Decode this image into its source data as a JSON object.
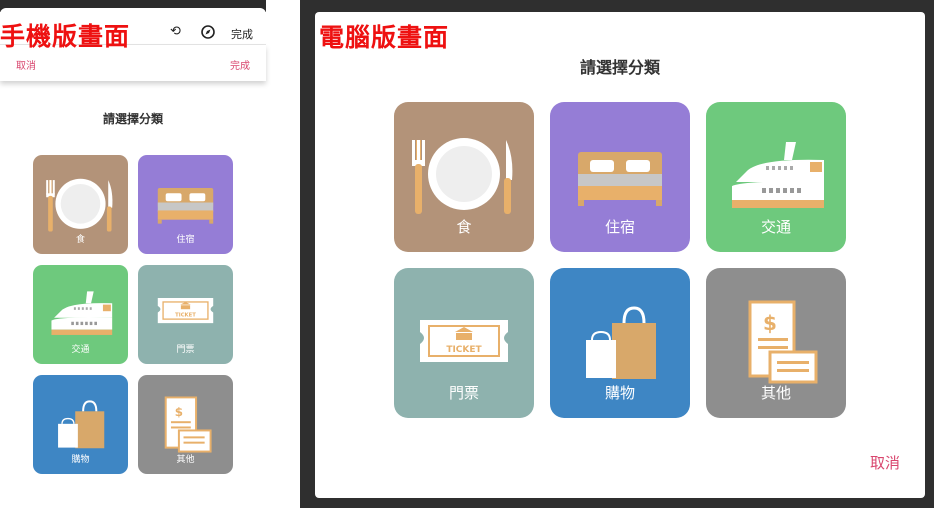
{
  "labels": {
    "mobile": "手機版畫面",
    "desktop": "電腦版畫面"
  },
  "mobile": {
    "toolbar": {
      "done_top": "完成",
      "undo_icon": "undo-icon",
      "compass_icon": "compass-icon"
    },
    "actions": {
      "cancel": "取消",
      "done": "完成"
    },
    "title": "請選擇分類"
  },
  "desktop": {
    "title": "請選擇分類",
    "cancel": "取消"
  },
  "categories": [
    {
      "label": "食",
      "icon": "food-icon",
      "color": "#b39379"
    },
    {
      "label": "住宿",
      "icon": "bed-icon",
      "color": "#957dd6"
    },
    {
      "label": "交通",
      "icon": "train-icon",
      "color": "#6ec97d"
    },
    {
      "label": "門票",
      "icon": "ticket-icon",
      "color": "#8eb2ae"
    },
    {
      "label": "購物",
      "icon": "shopping-bag-icon",
      "color": "#3e86c4"
    },
    {
      "label": "其他",
      "icon": "receipt-icon",
      "color": "#8e8e8e"
    }
  ],
  "ticket_text": "TICKET",
  "dollar_sign": "$"
}
